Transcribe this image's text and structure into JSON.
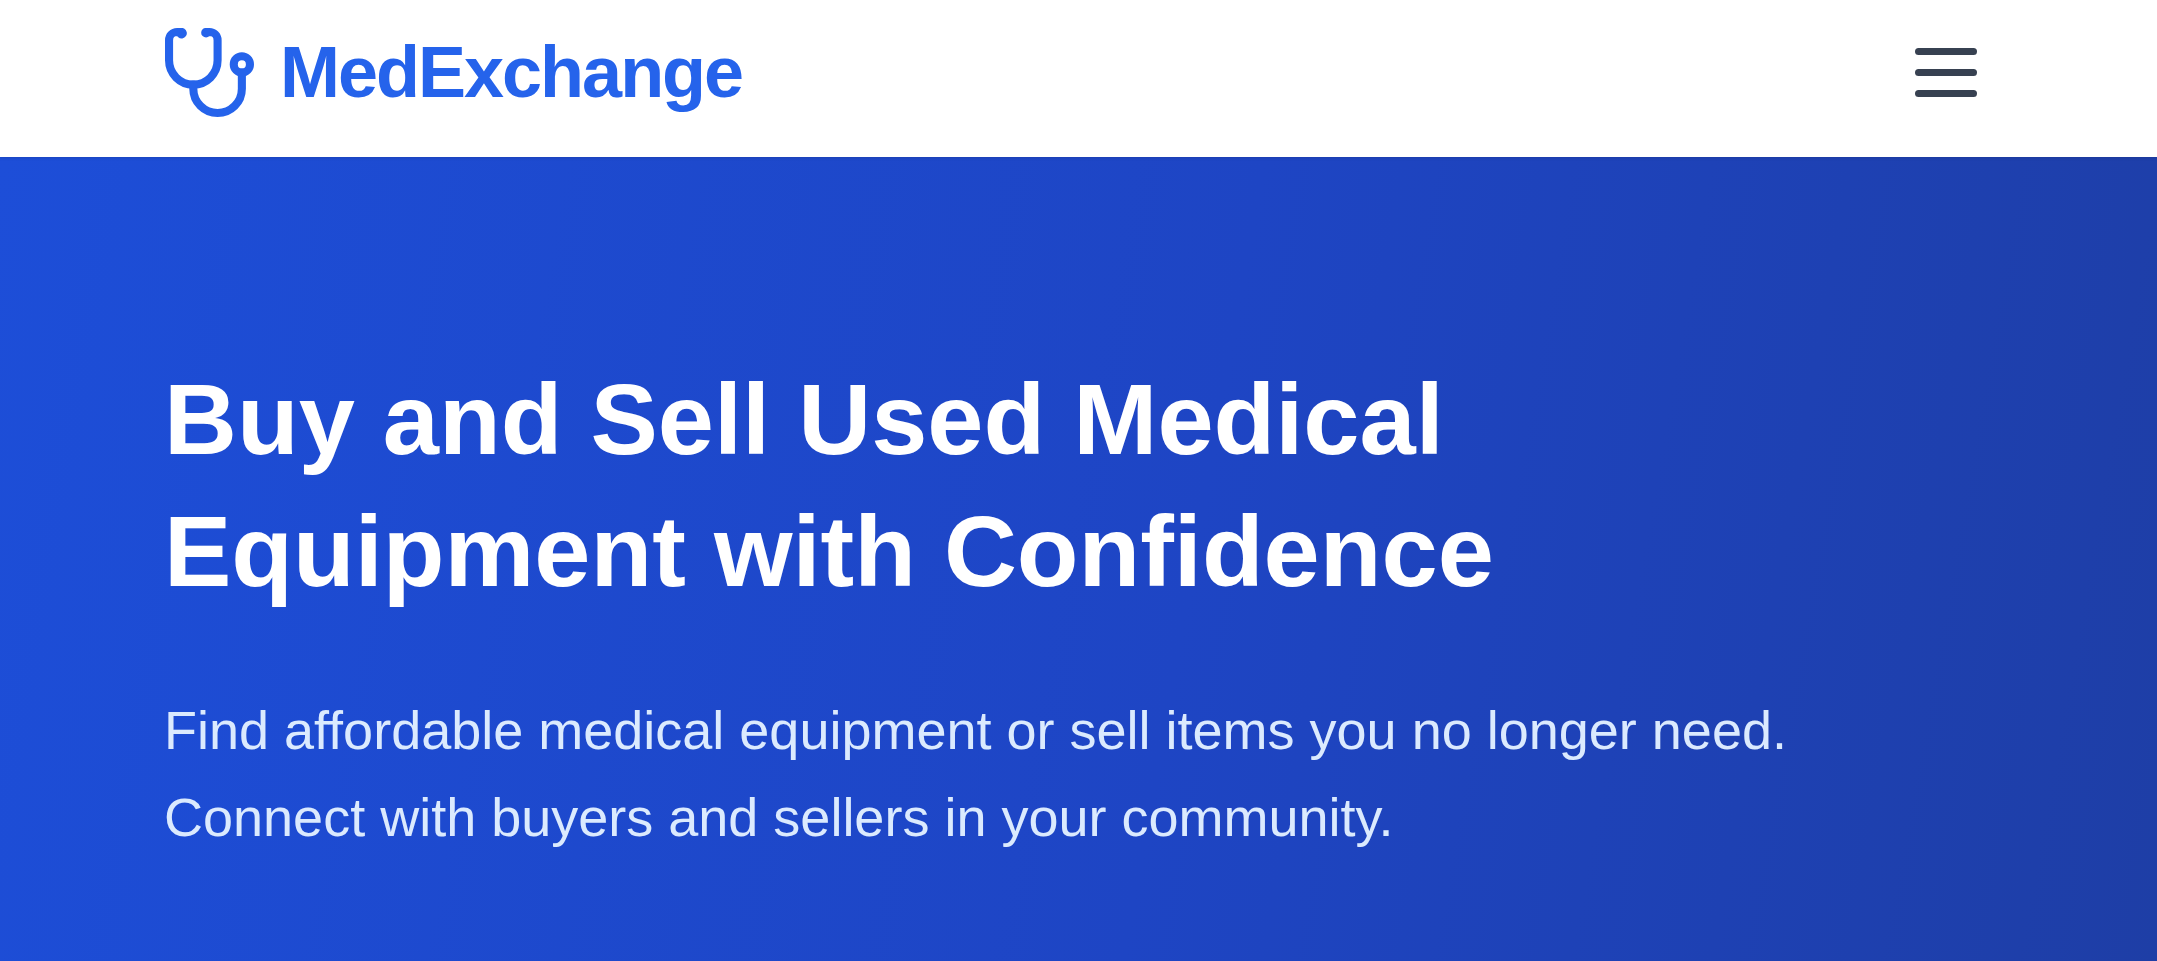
{
  "header": {
    "brand": "MedExchange"
  },
  "hero": {
    "title": "Buy and Sell Used Medical Equipment with Confidence",
    "subtitle": "Find affordable medical equipment or sell items you no longer need. Connect with buyers and sellers in your community."
  }
}
